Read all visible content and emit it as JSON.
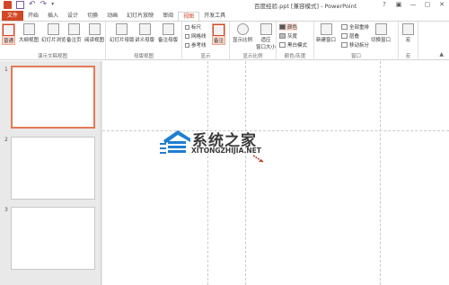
{
  "window": {
    "title": "百度经验.ppt [兼容模式] - PowerPoint",
    "controls": [
      "?",
      "▣",
      "—",
      "▢",
      "✕"
    ]
  },
  "tabs": [
    "文件",
    "开始",
    "插入",
    "设计",
    "切换",
    "动画",
    "幻灯片放映",
    "审阅",
    "视图",
    "开发工具"
  ],
  "active_tab": "视图",
  "ribbon": {
    "presentation_views": {
      "label": "演示文稿视图",
      "buttons": [
        "普通",
        "大纲视图",
        "幻灯片浏览",
        "备注页",
        "阅读视图"
      ]
    },
    "master_views": {
      "label": "母版视图",
      "buttons": [
        "幻灯片母版",
        "讲义母版",
        "备注母版"
      ]
    },
    "show": {
      "label": "显示",
      "checks": [
        "标尺",
        "网格线",
        "参考线"
      ],
      "notes_button": "备注"
    },
    "zoom": {
      "label": "显示比例",
      "buttons": [
        "显示比例",
        "适应\n窗口大小"
      ]
    },
    "color": {
      "label": "颜色/灰度",
      "options": [
        "颜色",
        "灰度",
        "黑白模式"
      ]
    },
    "window": {
      "label": "窗口",
      "new_window": "新建窗口",
      "options": [
        "全部重排",
        "层叠",
        "移动拆分"
      ],
      "switch": "切换窗口"
    },
    "macros": {
      "label": "宏",
      "button": "宏"
    }
  },
  "slides": [
    "1",
    "2",
    "3"
  ],
  "watermark": {
    "title": "系统之家",
    "url": "XITONGZHIJIA.NET"
  },
  "colors": {
    "accent": "#d24726",
    "selected_bg": "#fbd9cf",
    "thumb_selected": "#e37a55",
    "watermark_blue": "#1f7fd1"
  }
}
